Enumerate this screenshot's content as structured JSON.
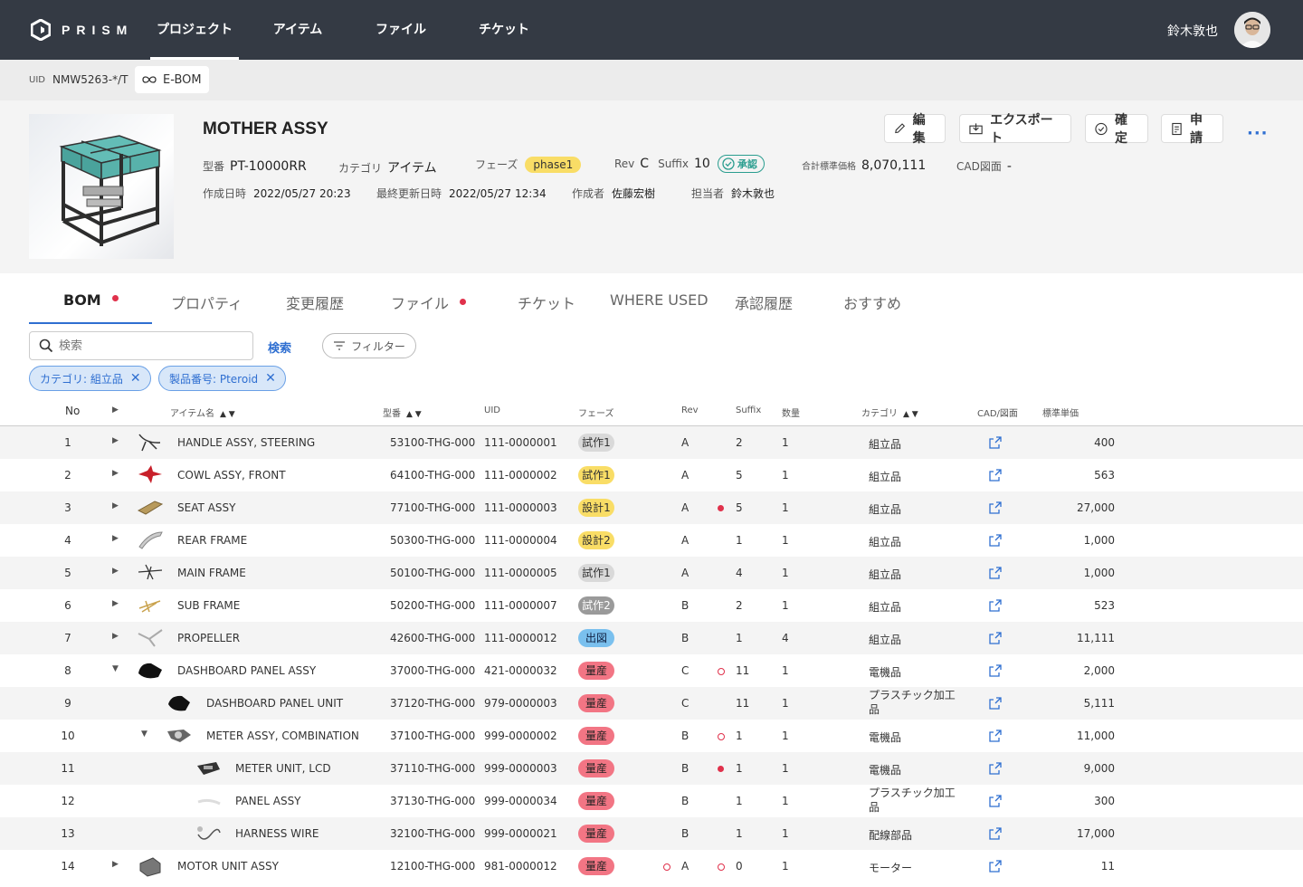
{
  "topbar": {
    "logo_text": "PRISM",
    "nav": [
      "プロジェクト",
      "アイテム",
      "ファイル",
      "チケット"
    ],
    "username": "鈴木敦也"
  },
  "crumb": {
    "uid_label": "UID",
    "uid_value": "NMW5263-*/T",
    "chip_label": "E-BOM"
  },
  "item": {
    "title": "MOTHER ASSY",
    "model_label": "型番",
    "model": "PT-10000RR",
    "category_label": "カテゴリ",
    "category": "アイテム",
    "phase_label": "フェーズ",
    "phase": "phase1",
    "rev_label": "Rev",
    "rev": "C",
    "suffix_label": "Suffix",
    "suffix": "10",
    "approval": "承認",
    "total_label": "合計標準価格",
    "total": "8,070,111",
    "cad_label": "CAD図面",
    "cad": "-",
    "created_label": "作成日時",
    "created": "2022/05/27 20:23",
    "updated_label": "最終更新日時",
    "updated": "2022/05/27 12:34",
    "author_label": "作成者",
    "author": "佐藤宏樹",
    "owner_label": "担当者",
    "owner": "鈴木敦也"
  },
  "actions": {
    "edit": "編集",
    "export": "エクスポート",
    "confirm": "確定",
    "apply": "申請",
    "more": "···"
  },
  "tabs": [
    {
      "label": "BOM",
      "dot": true
    },
    {
      "label": "プロパティ",
      "dot": false
    },
    {
      "label": "変更履歴",
      "dot": false
    },
    {
      "label": "ファイル",
      "dot": true
    },
    {
      "label": "チケット",
      "dot": false
    },
    {
      "label": "WHERE USED",
      "dot": false
    },
    {
      "label": "承認履歴",
      "dot": false
    },
    {
      "label": "おすすめ",
      "dot": false
    }
  ],
  "search": {
    "placeholder": "検索",
    "button": "検索",
    "filter": "フィルター"
  },
  "chips": [
    "カテゴリ: 組立品",
    "製品番号: Pteroid"
  ],
  "columns": {
    "no": "No",
    "name": "アイテム名",
    "model": "型番",
    "uid": "UID",
    "phase": "フェーズ",
    "rev": "Rev",
    "suffix": "Suffix",
    "qty": "数量",
    "category": "カテゴリ",
    "cad": "CAD/図面",
    "price": "標準単価"
  },
  "rows": [
    {
      "no": "1",
      "level": 0,
      "expand": "collapsed",
      "img": "steering",
      "name": "HANDLE ASSY, STEERING",
      "model": "53100-THG-000",
      "uid": "111-0000001",
      "phase": "試作1",
      "phase_color": "gray",
      "rev": "A",
      "rev_mark": "",
      "sfx_mark": "",
      "suffix": "2",
      "qty": "1",
      "category": "組立品",
      "price": "400"
    },
    {
      "no": "2",
      "level": 0,
      "expand": "collapsed",
      "img": "cowl",
      "name": "COWL ASSY, FRONT",
      "model": "64100-THG-000",
      "uid": "111-0000002",
      "phase": "試作1",
      "phase_color": "yellow",
      "rev": "A",
      "rev_mark": "",
      "sfx_mark": "",
      "suffix": "5",
      "qty": "1",
      "category": "組立品",
      "price": "563"
    },
    {
      "no": "3",
      "level": 0,
      "expand": "collapsed",
      "img": "seat",
      "name": "SEAT ASSY",
      "model": "77100-THG-000",
      "uid": "111-0000003",
      "phase": "設計1",
      "phase_color": "yellow",
      "rev": "A",
      "rev_mark": "",
      "sfx_mark": "filled",
      "suffix": "5",
      "qty": "1",
      "category": "組立品",
      "price": "27,000"
    },
    {
      "no": "4",
      "level": 0,
      "expand": "collapsed",
      "img": "rear",
      "name": "REAR FRAME",
      "model": "50300-THG-000",
      "uid": "111-0000004",
      "phase": "設計2",
      "phase_color": "yellow",
      "rev": "A",
      "rev_mark": "",
      "sfx_mark": "",
      "suffix": "1",
      "qty": "1",
      "category": "組立品",
      "price": "1,000"
    },
    {
      "no": "5",
      "level": 0,
      "expand": "collapsed",
      "img": "mainframe",
      "name": "MAIN FRAME",
      "model": "50100-THG-000",
      "uid": "111-0000005",
      "phase": "試作1",
      "phase_color": "gray",
      "rev": "A",
      "rev_mark": "",
      "sfx_mark": "",
      "suffix": "4",
      "qty": "1",
      "category": "組立品",
      "price": "1,000"
    },
    {
      "no": "6",
      "level": 0,
      "expand": "collapsed",
      "img": "subframe",
      "name": "SUB FRAME",
      "model": "50200-THG-000",
      "uid": "111-0000007",
      "phase": "試作2",
      "phase_color": "dark",
      "rev": "B",
      "rev_mark": "",
      "sfx_mark": "",
      "suffix": "2",
      "qty": "1",
      "category": "組立品",
      "price": "523"
    },
    {
      "no": "7",
      "level": 0,
      "expand": "collapsed",
      "img": "propeller",
      "name": "PROPELLER",
      "model": "42600-THG-000",
      "uid": "111-0000012",
      "phase": "出図",
      "phase_color": "blue",
      "rev": "B",
      "rev_mark": "",
      "sfx_mark": "",
      "suffix": "1",
      "qty": "4",
      "category": "組立品",
      "price": "11,111"
    },
    {
      "no": "8",
      "level": 0,
      "expand": "expanded",
      "img": "dashboard",
      "name": "DASHBOARD PANEL ASSY",
      "model": "37000-THG-000",
      "uid": "421-0000032",
      "phase": "量産",
      "phase_color": "red",
      "rev": "C",
      "rev_mark": "",
      "sfx_mark": "outline",
      "suffix": "11",
      "qty": "1",
      "category": "電機品",
      "price": "2,000"
    },
    {
      "no": "9",
      "level": 1,
      "expand": "none",
      "img": "dashunit",
      "name": "DASHBOARD PANEL UNIT",
      "model": "37120-THG-000",
      "uid": "979-0000003",
      "phase": "量産",
      "phase_color": "red",
      "rev": "C",
      "rev_mark": "",
      "sfx_mark": "",
      "suffix": "11",
      "qty": "1",
      "category": "プラスチック加工品",
      "price": "5,111"
    },
    {
      "no": "10",
      "level": 1,
      "expand": "expanded",
      "img": "meter",
      "name": "METER ASSY, COMBINATION",
      "model": "37100-THG-000",
      "uid": "999-0000002",
      "phase": "量産",
      "phase_color": "red",
      "rev": "B",
      "rev_mark": "",
      "sfx_mark": "outline",
      "suffix": "1",
      "qty": "1",
      "category": "電機品",
      "price": "11,000"
    },
    {
      "no": "11",
      "level": 2,
      "expand": "none",
      "img": "lcd",
      "name": "METER UNIT, LCD",
      "model": "37110-THG-000",
      "uid": "999-0000003",
      "phase": "量産",
      "phase_color": "red",
      "rev": "B",
      "rev_mark": "",
      "sfx_mark": "filled",
      "suffix": "1",
      "qty": "1",
      "category": "電機品",
      "price": "9,000"
    },
    {
      "no": "12",
      "level": 2,
      "expand": "none",
      "img": "panel",
      "name": "PANEL ASSY",
      "model": "37130-THG-000",
      "uid": "999-0000034",
      "phase": "量産",
      "phase_color": "red",
      "rev": "B",
      "rev_mark": "",
      "sfx_mark": "",
      "suffix": "1",
      "qty": "1",
      "category": "プラスチック加工品",
      "price": "300"
    },
    {
      "no": "13",
      "level": 2,
      "expand": "none",
      "img": "harness",
      "name": "HARNESS WIRE",
      "model": "32100-THG-000",
      "uid": "999-0000021",
      "phase": "量産",
      "phase_color": "red",
      "rev": "B",
      "rev_mark": "",
      "sfx_mark": "",
      "suffix": "1",
      "qty": "1",
      "category": "配線部品",
      "price": "17,000"
    },
    {
      "no": "14",
      "level": 0,
      "expand": "collapsed",
      "img": "motor",
      "name": "MOTOR UNIT ASSY",
      "model": "12100-THG-000",
      "uid": "981-0000012",
      "phase": "量産",
      "phase_color": "red",
      "rev": "A",
      "rev_mark": "outline",
      "sfx_mark": "outline",
      "suffix": "0",
      "qty": "1",
      "category": "モーター",
      "price": "11"
    }
  ]
}
